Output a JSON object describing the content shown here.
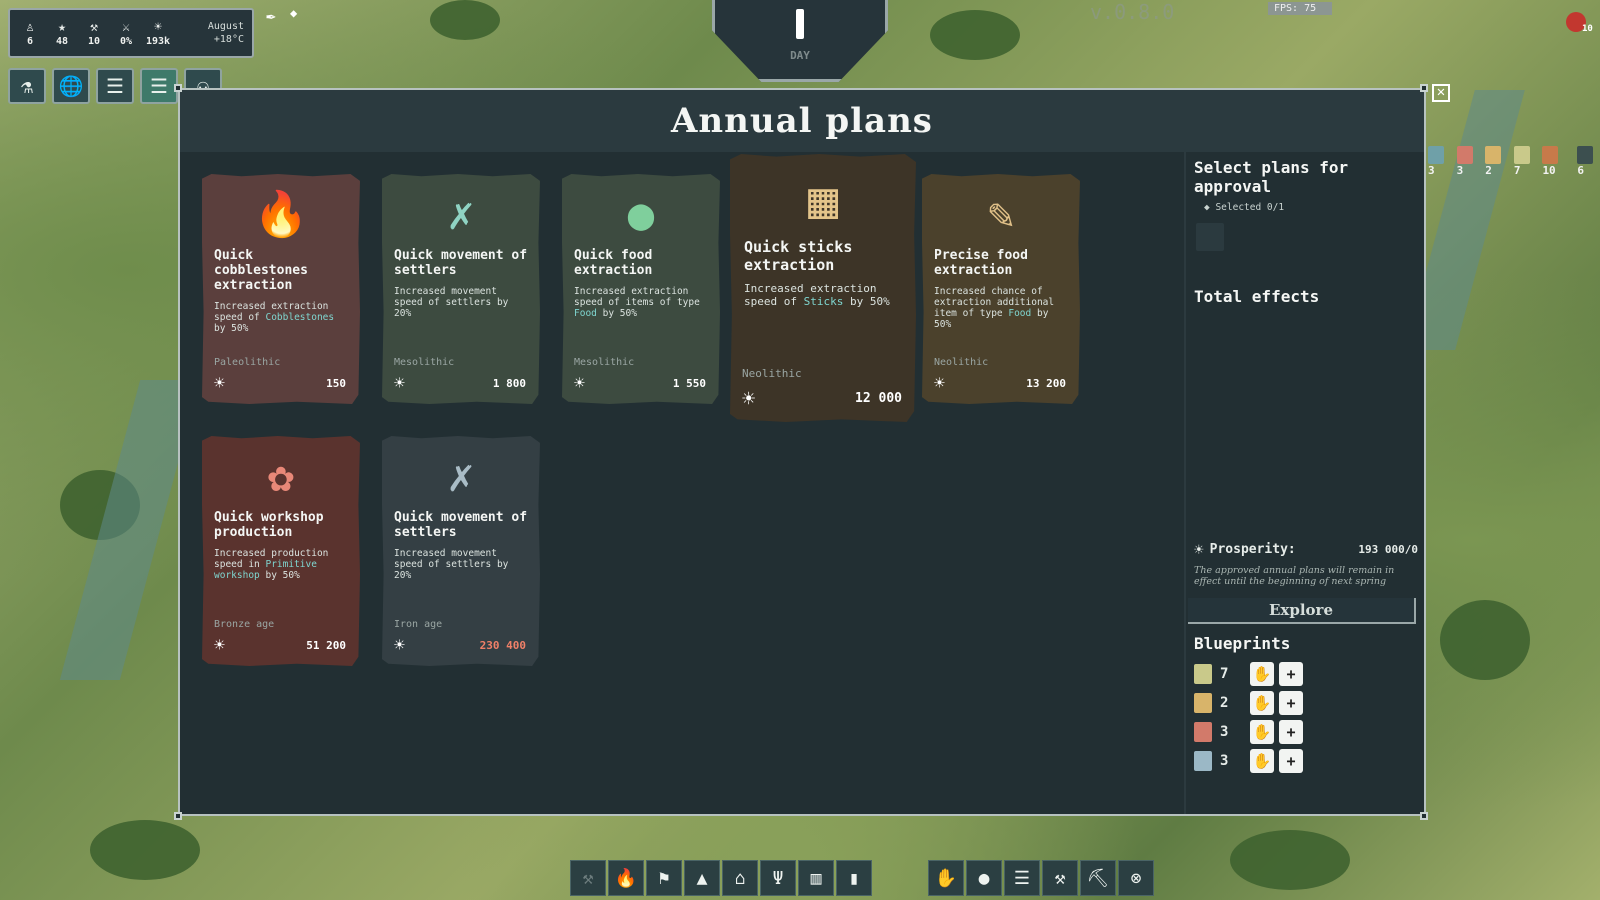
{
  "hud": {
    "stats": [
      {
        "icon": "person-icon",
        "glyph": "♙",
        "value": "6"
      },
      {
        "icon": "star-icon",
        "glyph": "★",
        "value": "48"
      },
      {
        "icon": "tool-icon",
        "glyph": "⚒",
        "value": "10"
      },
      {
        "icon": "sword-icon",
        "glyph": "⚔",
        "value": "0%"
      },
      {
        "icon": "sun-icon",
        "glyph": "☀",
        "value": "193k"
      }
    ],
    "month": "August",
    "temperature": "+18°C",
    "day_label": "DAY",
    "version": "v.0.8.0",
    "fps": "FPS: 75",
    "alert_count": "10"
  },
  "top_toolbar": [
    "⚗",
    "🌐",
    "☰",
    "☰",
    "⚇"
  ],
  "right_badges": [
    {
      "count": "3",
      "color": "#6fa0a8"
    },
    {
      "count": "3",
      "color": "#d27a6a"
    },
    {
      "count": "2",
      "color": "#d8b46a"
    },
    {
      "count": "7",
      "color": "#c9c98a"
    },
    {
      "count": "10",
      "color": "#c77a4a"
    },
    {
      "count": "6",
      "color": "#3c4f4f"
    }
  ],
  "dialog": {
    "title": "Annual plans",
    "close": "✕"
  },
  "plans": [
    {
      "title": "Quick cobblestones extraction",
      "desc_pre": "Increased extraction speed of ",
      "highlight": "Cobblestones",
      "desc_post": " by 50%",
      "era": "Paleolithic",
      "cost": "150",
      "icon": "flame-icon",
      "glyph": "🔥",
      "bg": "#5b3f3d",
      "icon_color": "#e08a7a"
    },
    {
      "title": "Quick movement of settlers",
      "desc_pre": "Increased movement speed of settlers by ",
      "highlight": "",
      "desc_post": "20%",
      "era": "Mesolithic",
      "cost": "1 800",
      "icon": "running-figure-icon",
      "glyph": "✗",
      "bg": "#3d4b40",
      "icon_color": "#8fd3c3"
    },
    {
      "title": "Quick food extraction",
      "desc_pre": "Increased extraction speed of items of type ",
      "highlight": "Food",
      "desc_post": " by 50%",
      "era": "Mesolithic",
      "cost": "1 550",
      "icon": "apple-icon",
      "glyph": "●",
      "bg": "#3d4b40",
      "icon_color": "#7fcf9c"
    },
    {
      "title": "Quick sticks extraction",
      "desc_pre": "Increased extraction speed of ",
      "highlight": "Sticks",
      "desc_post": " by 50%",
      "era": "Neolithic",
      "cost": "12 000",
      "icon": "sticks-icon",
      "glyph": "▦",
      "bg": "#3d3427",
      "icon_color": "#e3c48a"
    },
    {
      "title": "Precise food extraction",
      "desc_pre": "Increased chance of extraction additional item of type ",
      "highlight": "Food",
      "desc_post": " by 50%",
      "era": "Neolithic",
      "cost": "13 200",
      "icon": "leaf-axe-icon",
      "glyph": "✎",
      "bg": "#4b412c",
      "icon_color": "#e0c088"
    },
    {
      "title": "Quick workshop production",
      "desc_pre": "Increased production speed in ",
      "highlight": "Primitive workshop",
      "desc_post": " by 50%",
      "era": "Bronze age",
      "cost": "51 200",
      "icon": "hide-icon",
      "glyph": "✿",
      "bg": "#5a332e",
      "icon_color": "#e88878"
    },
    {
      "title": "Quick movement of settlers",
      "desc_pre": "Increased movement speed of settlers by ",
      "highlight": "",
      "desc_post": "20%",
      "era": "Iron age",
      "cost": "230 400",
      "icon": "running-figure-icon",
      "glyph": "✗",
      "bg": "#343f44",
      "icon_color": "#a9bcc6"
    }
  ],
  "side": {
    "select_title": "Select plans for approval",
    "selected": "Selected 0/1",
    "total_title": "Total effects",
    "prosperity_label": "Prosperity:",
    "prosperity_value": "193 000/0",
    "note": "The approved annual plans will remain in effect until the beginning of next spring",
    "explore": "Explore",
    "blueprints_title": "Blueprints",
    "blueprints": [
      {
        "count": "7",
        "color": "#c9c98a"
      },
      {
        "count": "2",
        "color": "#d8b46a"
      },
      {
        "count": "3",
        "color": "#d27a6a"
      },
      {
        "count": "3",
        "color": "#9bb8c6"
      }
    ]
  },
  "bottom_left": [
    "⚒",
    "🔥",
    "⚑",
    "▲",
    "⌂",
    "Ψ",
    "▥",
    "▮"
  ],
  "bottom_right": [
    "✋",
    "●",
    "☰",
    "⚒",
    "⛏",
    "⊗"
  ]
}
